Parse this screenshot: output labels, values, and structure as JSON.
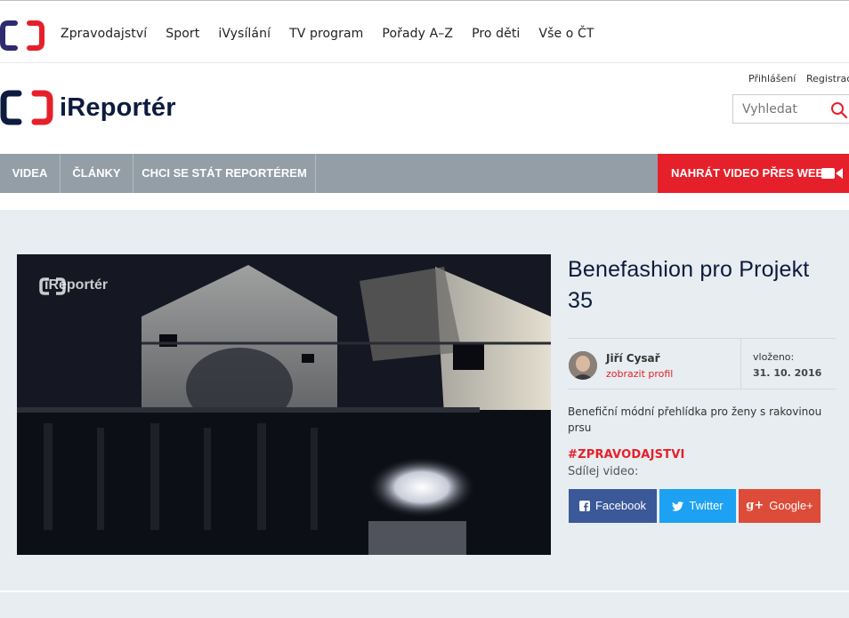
{
  "top_nav": {
    "items": [
      "Zpravodajství",
      "Sport",
      "iVysílání",
      "TV program",
      "Pořady A–Z",
      "Pro děti",
      "Vše o ČT"
    ]
  },
  "brand": {
    "title": "iReportér"
  },
  "auth": {
    "login": "Přihlášení",
    "register": "Registrace"
  },
  "search": {
    "placeholder": "Vyhledat"
  },
  "main_nav": {
    "items": [
      "VIDEA",
      "ČLÁNKY",
      "CHCI SE STÁT REPORTÉREM"
    ],
    "upload_label": "NAHRÁT VIDEO PŘES WEB"
  },
  "video": {
    "watermark": "iReportér"
  },
  "article": {
    "title": "Benefashion pro Projekt 35",
    "author_name": "Jiří Cysař",
    "profile_link": "zobrazit profil",
    "posted_label": "vloženo:",
    "posted_date": "31. 10. 2016",
    "description": "Benefiční módní přehlídka pro ženy s rakovinou prsu",
    "tag": "#ZPRAVODAJSTVI",
    "share_label": "Sdílej video:"
  },
  "share_buttons": {
    "facebook": "Facebook",
    "twitter": "Twitter",
    "google": "Google+"
  },
  "colors": {
    "ct_red": "#e6202a",
    "ct_navy": "#0d1b3e",
    "nav_grey": "#939ea6",
    "facebook": "#3b5998",
    "twitter": "#1da1f2",
    "google": "#dd4b39"
  },
  "icons": [
    "ct-logo-icon",
    "search-icon",
    "video-camera-icon",
    "facebook-icon",
    "twitter-icon",
    "google-plus-icon"
  ]
}
